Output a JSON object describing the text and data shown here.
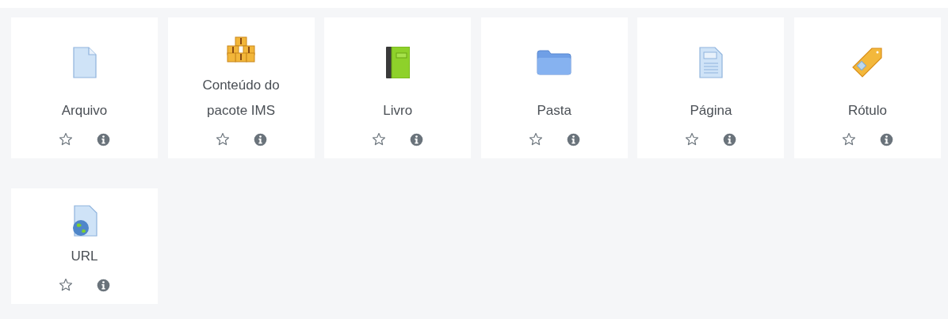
{
  "activities": [
    {
      "label": "Arquivo",
      "kind": "file",
      "starred": false
    },
    {
      "label": "Conteúdo do pacote IMS",
      "kind": "package",
      "starred": false
    },
    {
      "label": "Livro",
      "kind": "book",
      "starred": false
    },
    {
      "label": "Pasta",
      "kind": "folder",
      "starred": false
    },
    {
      "label": "Página",
      "kind": "page",
      "starred": false
    },
    {
      "label": "Rótulo",
      "kind": "label",
      "starred": false
    },
    {
      "label": "URL",
      "kind": "url",
      "starred": false
    }
  ]
}
